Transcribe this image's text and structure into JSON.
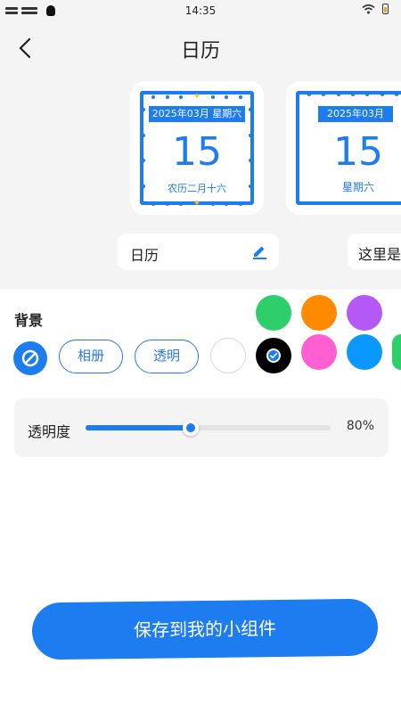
{
  "status_bar": {
    "time": "14:35"
  },
  "nav": {
    "title": "日历",
    "back_icon": "chevron-left-icon"
  },
  "preview_cards": [
    {
      "header": "2025年03月 星期六",
      "day": "15",
      "subtitle": "农历二月十六",
      "name": "日历"
    },
    {
      "header": "2025年03月",
      "day": "15",
      "subtitle": "星期六",
      "name": "这里是"
    }
  ],
  "background": {
    "label": "背景",
    "none_icon": "no-background-icon",
    "album_label": "相册",
    "transparent_label": "透明",
    "colors_row1": [
      "#2dcf6a",
      "#ff8a00",
      "#b459f5"
    ],
    "colors_row2": [
      "#ffffff",
      "#000000",
      "#ff5fd0",
      "#0a98ff",
      "#2dcf6a"
    ],
    "selected_color": "#000000"
  },
  "opacity": {
    "label": "透明度",
    "value_text": "80%",
    "level": 0.43
  },
  "accent_color": "#1c7cf0",
  "save_button": {
    "label": "保存到我的小组件"
  }
}
